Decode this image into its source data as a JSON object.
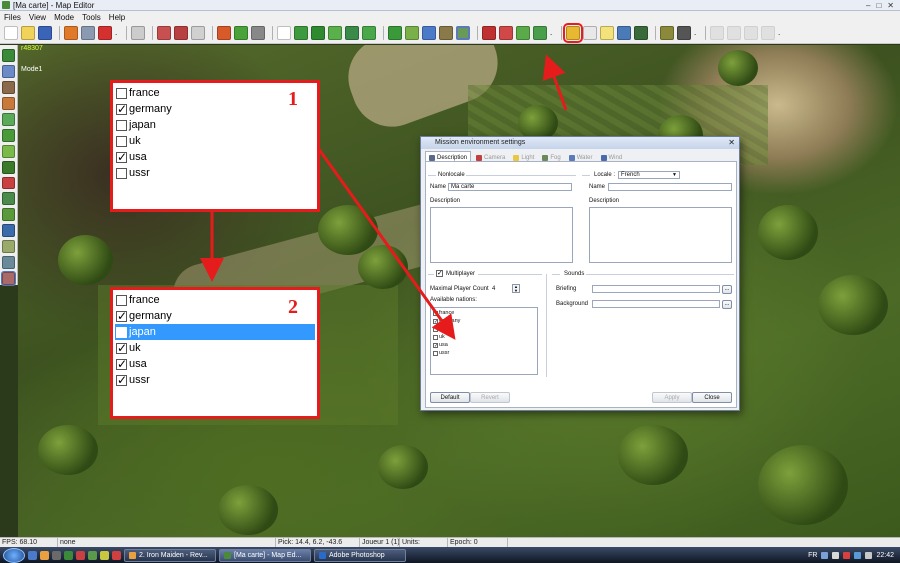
{
  "window": {
    "title": "[Ma carte] - Map Editor",
    "controls": [
      "–",
      "□",
      "✕"
    ]
  },
  "menu": [
    "Files",
    "View",
    "Mode",
    "Tools",
    "Help"
  ],
  "viewport": {
    "coords": "r48307",
    "mode": "Mode1"
  },
  "popups": [
    {
      "number": "1",
      "nations": [
        {
          "name": "france",
          "checked": false,
          "selected": false
        },
        {
          "name": "germany",
          "checked": true,
          "selected": false
        },
        {
          "name": "japan",
          "checked": false,
          "selected": false
        },
        {
          "name": "uk",
          "checked": false,
          "selected": false
        },
        {
          "name": "usa",
          "checked": true,
          "selected": false
        },
        {
          "name": "ussr",
          "checked": false,
          "selected": false
        }
      ]
    },
    {
      "number": "2",
      "nations": [
        {
          "name": "france",
          "checked": false,
          "selected": false
        },
        {
          "name": "germany",
          "checked": true,
          "selected": false
        },
        {
          "name": "japan",
          "checked": false,
          "selected": true
        },
        {
          "name": "uk",
          "checked": true,
          "selected": false
        },
        {
          "name": "usa",
          "checked": true,
          "selected": false
        },
        {
          "name": "ussr",
          "checked": true,
          "selected": false
        }
      ]
    }
  ],
  "dialog": {
    "title": "Mission environment settings",
    "tabs": [
      "Description",
      "Camera",
      "Light",
      "Fog",
      "Water",
      "Wind"
    ],
    "nonlocale_label": "Nonlocale",
    "locale_label": "Locale :",
    "locale_value": "French",
    "name_label": "Name",
    "name_value": "Ma carte",
    "description_label": "Description",
    "multiplayer_label": "Multiplayer",
    "max_players_label": "Maximal Player Count",
    "max_players_value": "4",
    "available_nations_label": "Available nations:",
    "nations": [
      {
        "name": "france",
        "checked": false
      },
      {
        "name": "germany",
        "checked": true
      },
      {
        "name": "japan",
        "checked": false
      },
      {
        "name": "uk",
        "checked": false
      },
      {
        "name": "usa",
        "checked": true
      },
      {
        "name": "ussr",
        "checked": false
      }
    ],
    "sounds_label": "Sounds",
    "briefing_label": "Briefing",
    "background_label": "Background",
    "buttons": {
      "default": "Default",
      "revert": "Revert",
      "apply": "Apply",
      "close": "Close"
    }
  },
  "statusbar": {
    "fps": "FPS: 68.10",
    "selection": "none",
    "pick": "Pick: 14.4, 6.2, -43.6",
    "player": "Joueur 1 (1)",
    "units": "Units:",
    "epoch": "Epoch: 0"
  },
  "taskbar": {
    "tasks": [
      "2. Iron Maiden - Rev...",
      "[Ma carte] - Map Ed...",
      "Adobe Photoshop"
    ],
    "lang": "FR",
    "clock": "22:42"
  }
}
